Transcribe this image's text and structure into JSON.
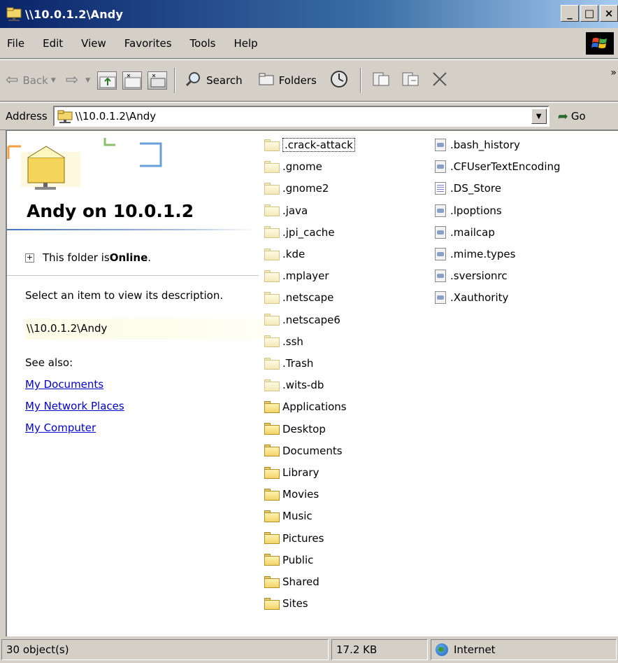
{
  "window": {
    "title": "\\\\10.0.1.2\\Andy",
    "controls": {
      "minimize": "_",
      "maximize": "□",
      "close": "×"
    }
  },
  "menu": [
    "File",
    "Edit",
    "View",
    "Favorites",
    "Tools",
    "Help"
  ],
  "toolbar": {
    "back": "Back",
    "search": "Search",
    "folders": "Folders",
    "more": "»"
  },
  "address": {
    "label": "Address",
    "value": "\\\\10.0.1.2\\Andy",
    "go": "Go"
  },
  "webview": {
    "title": "Andy on 10.0.1.2",
    "status_prefix": "This folder is ",
    "status_bold": "Online",
    "status_suffix": ".",
    "description": "Select an item to view its description.",
    "path": "\\\\10.0.1.2\\Andy",
    "see_also": "See also:",
    "links": [
      "My Documents",
      "My Network Places",
      "My Computer"
    ]
  },
  "files": {
    "column1": [
      {
        "name": ".crack-attack",
        "type": "folder",
        "hidden": true,
        "focused": true
      },
      {
        "name": ".gnome",
        "type": "folder",
        "hidden": true
      },
      {
        "name": ".gnome2",
        "type": "folder",
        "hidden": true
      },
      {
        "name": ".java",
        "type": "folder",
        "hidden": true
      },
      {
        "name": ".jpi_cache",
        "type": "folder",
        "hidden": true
      },
      {
        "name": ".kde",
        "type": "folder",
        "hidden": true
      },
      {
        "name": ".mplayer",
        "type": "folder",
        "hidden": true
      },
      {
        "name": ".netscape",
        "type": "folder",
        "hidden": true
      },
      {
        "name": ".netscape6",
        "type": "folder",
        "hidden": true
      },
      {
        "name": ".ssh",
        "type": "folder",
        "hidden": true
      },
      {
        "name": ".Trash",
        "type": "folder",
        "hidden": true
      },
      {
        "name": ".wits-db",
        "type": "folder",
        "hidden": true
      },
      {
        "name": "Applications",
        "type": "folder"
      },
      {
        "name": "Desktop",
        "type": "folder"
      },
      {
        "name": "Documents",
        "type": "folder"
      },
      {
        "name": "Library",
        "type": "folder"
      },
      {
        "name": "Movies",
        "type": "folder"
      },
      {
        "name": "Music",
        "type": "folder"
      },
      {
        "name": "Pictures",
        "type": "folder"
      },
      {
        "name": "Public",
        "type": "folder"
      },
      {
        "name": "Shared",
        "type": "folder"
      },
      {
        "name": "Sites",
        "type": "folder"
      }
    ],
    "column2": [
      {
        "name": ".bash_history",
        "type": "file"
      },
      {
        "name": ".CFUserTextEncoding",
        "type": "file"
      },
      {
        "name": ".DS_Store",
        "type": "ds"
      },
      {
        "name": ".lpoptions",
        "type": "file"
      },
      {
        "name": ".mailcap",
        "type": "file"
      },
      {
        "name": ".mime.types",
        "type": "file"
      },
      {
        "name": ".sversionrc",
        "type": "file"
      },
      {
        "name": ".Xauthority",
        "type": "file"
      }
    ]
  },
  "statusbar": {
    "objects": "30 object(s)",
    "size": "17.2 KB",
    "zone": "Internet"
  }
}
